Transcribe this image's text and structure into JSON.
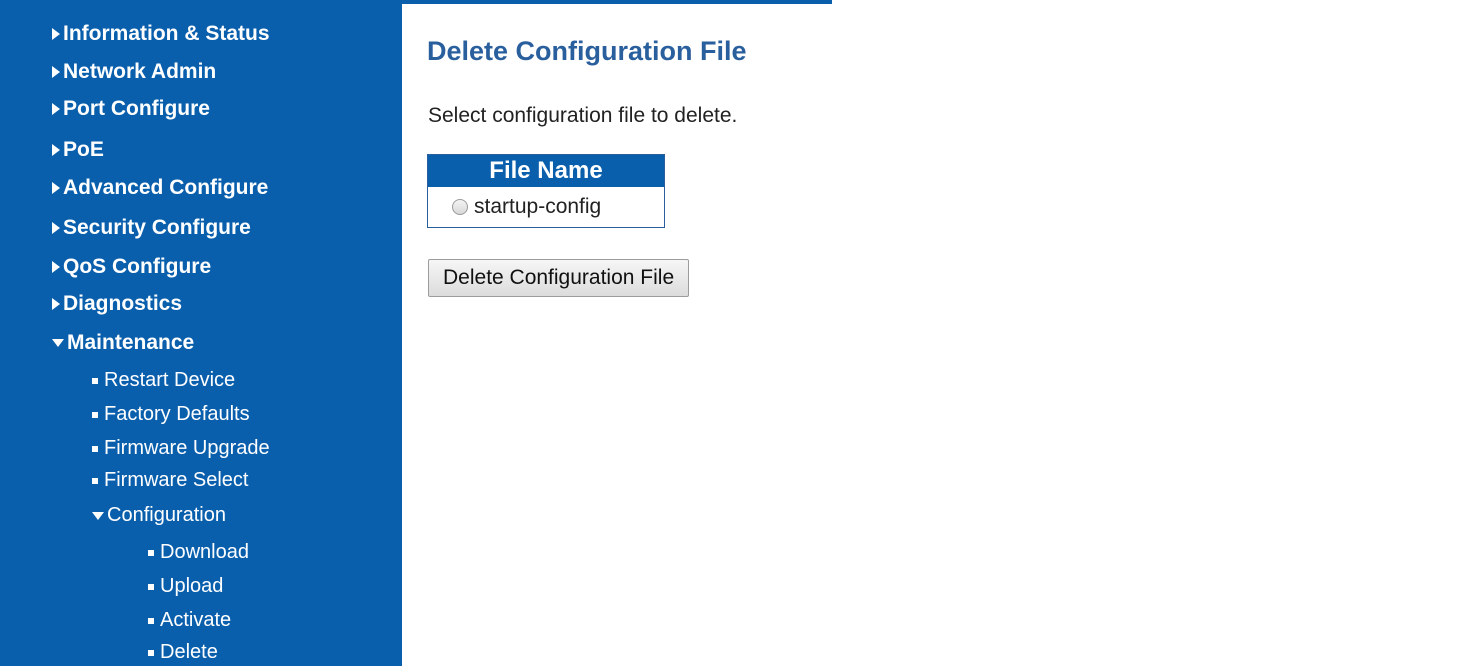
{
  "sidebar": {
    "items": [
      {
        "label": "Information & Status",
        "expanded": false
      },
      {
        "label": "Network Admin",
        "expanded": false
      },
      {
        "label": "Port Configure",
        "expanded": false
      },
      {
        "label": "PoE",
        "expanded": false
      },
      {
        "label": "Advanced Configure",
        "expanded": false
      },
      {
        "label": "Security Configure",
        "expanded": false
      },
      {
        "label": "QoS Configure",
        "expanded": false
      },
      {
        "label": "Diagnostics",
        "expanded": false
      },
      {
        "label": "Maintenance",
        "expanded": true
      }
    ],
    "maintenance_items": [
      {
        "label": "Restart Device"
      },
      {
        "label": "Factory Defaults"
      },
      {
        "label": "Firmware Upgrade"
      },
      {
        "label": "Firmware Select"
      }
    ],
    "configuration": {
      "label": "Configuration",
      "expanded": true
    },
    "configuration_items": [
      {
        "label": "Download"
      },
      {
        "label": "Upload"
      },
      {
        "label": "Activate"
      },
      {
        "label": "Delete"
      }
    ]
  },
  "main": {
    "title": "Delete Configuration File",
    "instruction": "Select configuration file to delete.",
    "table": {
      "header": "File Name",
      "rows": [
        {
          "name": "startup-config",
          "selected": false
        }
      ]
    },
    "delete_button": "Delete Configuration File"
  },
  "colors": {
    "sidebar_bg": "#0a5fad",
    "title": "#2a5f9e"
  }
}
